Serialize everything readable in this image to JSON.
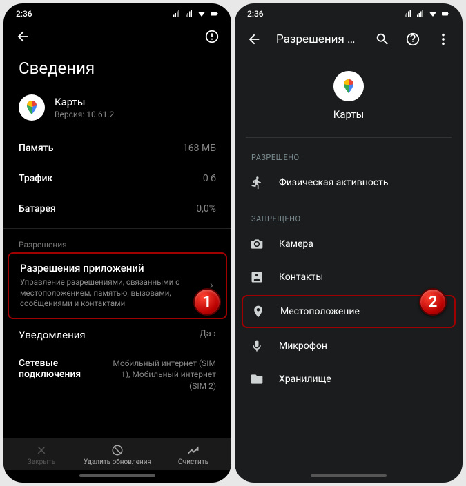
{
  "status": {
    "time": "2:36"
  },
  "left": {
    "pageTitle": "Сведения",
    "app": {
      "name": "Карты",
      "version": "Версия: 10.61.2"
    },
    "rows": {
      "memLabel": "Память",
      "memVal": "168 МБ",
      "trafLabel": "Трафик",
      "trafVal": "0 б",
      "batLabel": "Батарея",
      "batVal": "0,0%"
    },
    "permSection": "Разрешения",
    "perm": {
      "title": "Разрешения приложений",
      "desc": "Управление разрешениями, связанными с местоположением, памятью, вызовами, сообщениями и контактами"
    },
    "notif": {
      "label": "Уведомления",
      "val": "Да"
    },
    "net": {
      "label": "Сетевые подключения",
      "val": "Мобильный интернет (SIM 1), Мобильный интернет (SIM 2)"
    },
    "bottom": {
      "close": "Закрыть",
      "uninstall": "Удалить обновления",
      "clear": "Очистить"
    }
  },
  "right": {
    "title": "Разрешения при..",
    "app": "Карты",
    "allowed": "Разрешено",
    "denied": "Запрещено",
    "items": {
      "activity": "Физическая активность",
      "camera": "Камера",
      "contacts": "Контакты",
      "location": "Местоположение",
      "mic": "Микрофон",
      "storage": "Хранилище"
    }
  },
  "badges": {
    "b1": "1",
    "b2": "2"
  }
}
